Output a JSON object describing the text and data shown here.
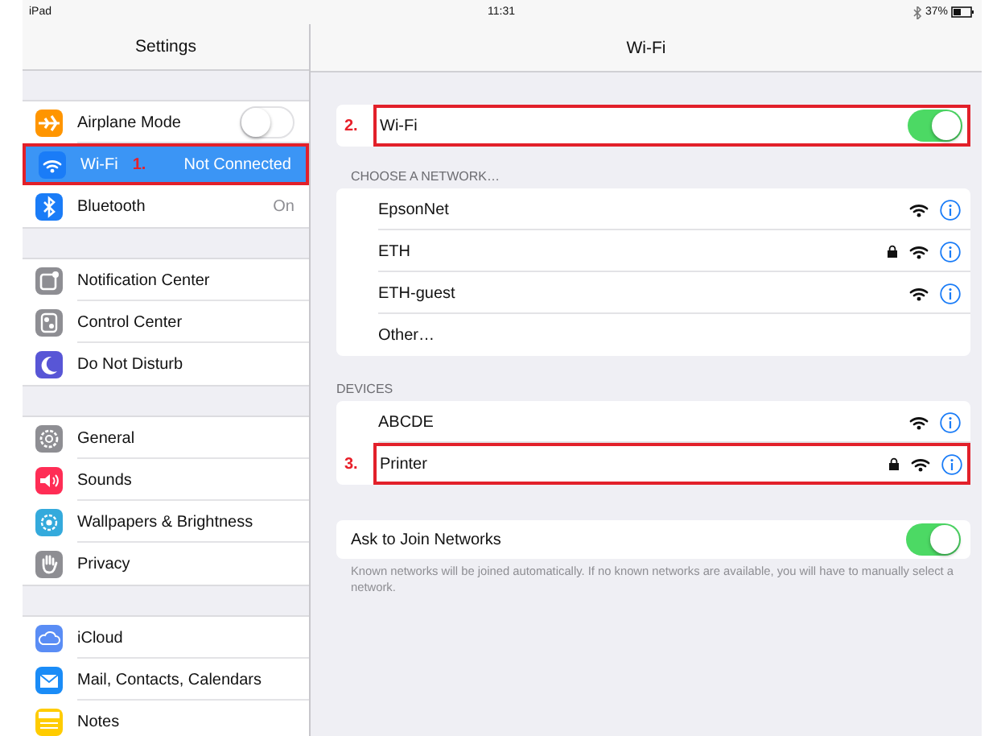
{
  "status_bar": {
    "device": "iPad",
    "time": "11:31",
    "bluetooth": true,
    "battery": "37%"
  },
  "sidebar": {
    "title": "Settings",
    "groups": [
      {
        "items": [
          {
            "label": "Airplane Mode",
            "kind": "toggle",
            "on": false,
            "selected": false
          },
          {
            "label": "Wi-Fi",
            "kind": "value",
            "value": "Not Connected",
            "selected": true,
            "callout": "1."
          },
          {
            "label": "Bluetooth",
            "kind": "value",
            "value": "On",
            "selected": false
          }
        ]
      },
      {
        "items": [
          {
            "label": "Notification Center",
            "kind": "plain",
            "selected": false
          },
          {
            "label": "Control Center",
            "kind": "plain",
            "selected": false
          },
          {
            "label": "Do Not Disturb",
            "kind": "plain",
            "selected": false
          }
        ]
      },
      {
        "items": [
          {
            "label": "General",
            "kind": "plain",
            "selected": false
          },
          {
            "label": "Sounds",
            "kind": "plain",
            "selected": false
          },
          {
            "label": "Wallpapers & Brightness",
            "kind": "plain",
            "selected": false
          },
          {
            "label": "Privacy",
            "kind": "plain",
            "selected": false
          }
        ]
      },
      {
        "items": [
          {
            "label": "iCloud",
            "kind": "plain",
            "selected": false
          },
          {
            "label": "Mail, Contacts, Calendars",
            "kind": "plain",
            "selected": false
          },
          {
            "label": "Notes",
            "kind": "plain",
            "selected": false
          }
        ]
      }
    ]
  },
  "detail": {
    "title": "Wi-Fi",
    "wifi": {
      "label": "Wi-Fi",
      "on": true,
      "callout": "2."
    },
    "networks": {
      "header": "CHOOSE A NETWORK…",
      "items": [
        {
          "kind": "network",
          "name": "EpsonNet",
          "locked": false
        },
        {
          "kind": "network",
          "name": "ETH",
          "locked": true
        },
        {
          "kind": "network",
          "name": "ETH-guest",
          "locked": false
        },
        {
          "kind": "other",
          "name": "Other…"
        }
      ]
    },
    "devices": {
      "header": "DEVICES",
      "items": [
        {
          "kind": "network",
          "name": "ABCDE",
          "locked": false
        },
        {
          "kind": "network",
          "name": "Printer",
          "locked": true,
          "callout": "3."
        }
      ]
    },
    "ask": {
      "label": "Ask to Join Networks",
      "on": true,
      "footnote": "Known networks will be joined automatically. If no known networks are available, you will have to manually select a network."
    }
  }
}
